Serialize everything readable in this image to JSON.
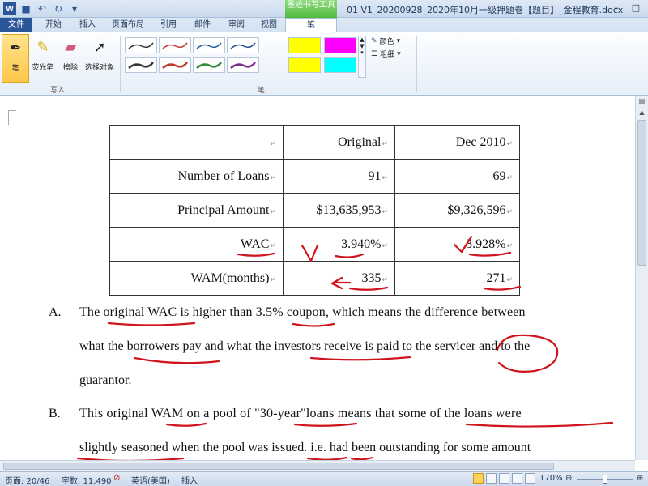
{
  "app": {
    "window_title": "01 V1_20200928_2020年10月一级押题卷【题目】_金程教育.docx",
    "context_tab_group": "墨迹书写工具"
  },
  "tabs": [
    {
      "label": "文件"
    },
    {
      "label": "开始"
    },
    {
      "label": "插入"
    },
    {
      "label": "页面布局"
    },
    {
      "label": "引用"
    },
    {
      "label": "邮件"
    },
    {
      "label": "审阅"
    },
    {
      "label": "视图"
    },
    {
      "label": "笔"
    }
  ],
  "ribbon": {
    "write_group": {
      "label": "写入",
      "tools": [
        {
          "label": "笔",
          "icon": "pen-icon"
        },
        {
          "label": "荧光笔",
          "icon": "highlighter-icon"
        },
        {
          "label": "擦除",
          "icon": "eraser-icon"
        },
        {
          "label": "选择对象",
          "icon": "select-cursor-icon"
        }
      ]
    },
    "pens_group": {
      "label": "笔",
      "color_label": "颜色",
      "thickness_label": "粗细",
      "pen_colors": [
        "#333333",
        "#c0392b",
        "#1f5fa8",
        "#1f4e8c",
        "#333333",
        "#c0392b",
        "#2e8b3a",
        "#7a2c8a"
      ],
      "highlight_colors": [
        "#ffff00",
        "#ff00ff",
        "#ffff00",
        "#00ffff"
      ]
    }
  },
  "table": {
    "rows": [
      [
        "",
        "Original",
        "Dec 2010"
      ],
      [
        "Number of Loans",
        "91",
        "69"
      ],
      [
        "Principal Amount",
        "$13,635,953",
        "$9,326,596"
      ],
      [
        "WAC",
        "3.940%",
        "3.928%"
      ],
      [
        "WAM(months)",
        "335",
        "271"
      ]
    ]
  },
  "options": [
    {
      "label": "A.",
      "lines": [
        "The original WAC is higher than 3.5% coupon, which means the difference between",
        "what the borrowers pay and what the investors receive is paid to the servicer and to the",
        "guarantor."
      ]
    },
    {
      "label": "B.",
      "lines": [
        "This original WAM on a pool of \"30-year\"loans means that some of the loans were",
        "slightly seasoned when the pool was issued. i.e. had been outstanding for some amount"
      ]
    }
  ],
  "statusbar": {
    "page": "页面: 20/46",
    "words": "字数: 11,490",
    "language": "英语(美国)",
    "mode": "插入",
    "zoom": "170%"
  },
  "ink_color": "#d0141e"
}
